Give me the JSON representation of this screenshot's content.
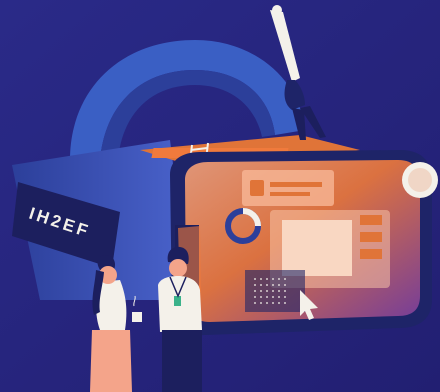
{
  "headset": {
    "brand_label": "IH2EF"
  },
  "colors": {
    "background": "#2c2a86",
    "background_dark": "#201d6b",
    "strap": "#3a5fc4",
    "strap_dark": "#2c3f9a",
    "headset_body": "#3d4fb8",
    "headset_dark": "#1e2468",
    "accent_orange": "#f07a3c",
    "accent_pink": "#f4a48a",
    "visor_glow": "#f38b55",
    "white": "#f4f1ea"
  },
  "icons": [
    "headset-illustration",
    "diver-figure",
    "ladder-icon",
    "mouse-cursor-icon",
    "user-card-icon",
    "donut-chart-icon",
    "coffee-cup-icon"
  ]
}
